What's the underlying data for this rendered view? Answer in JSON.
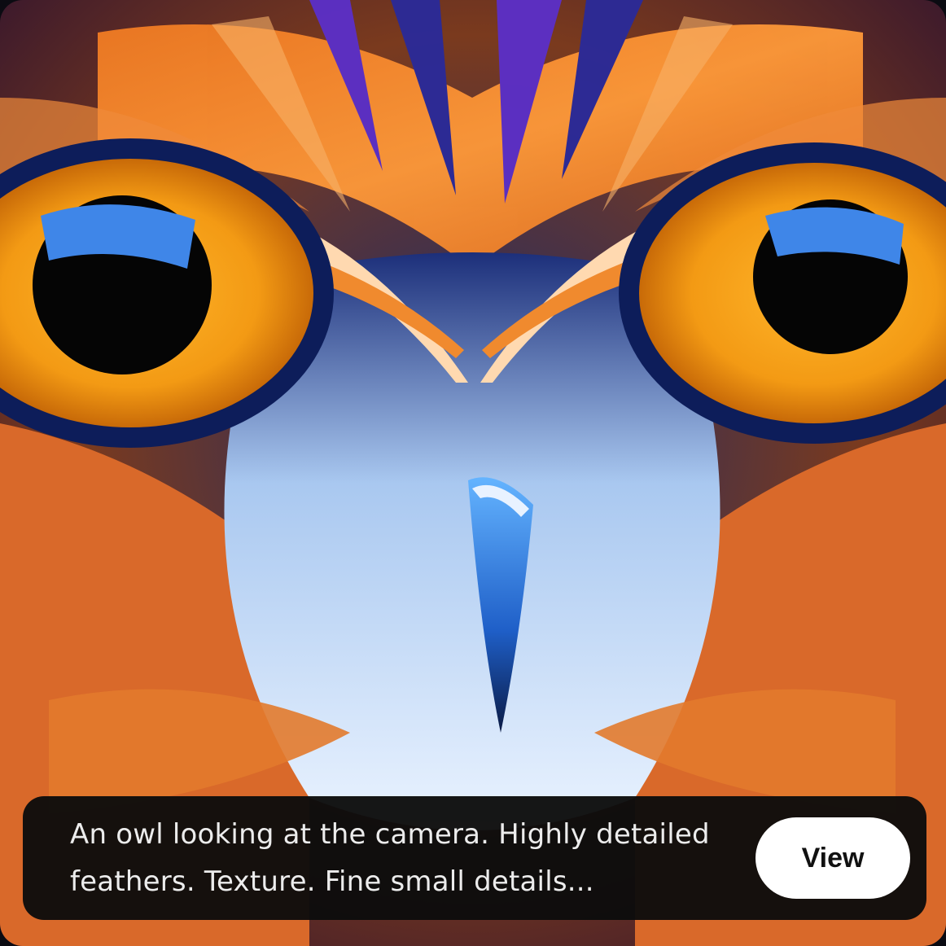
{
  "card": {
    "image_subject": "owl-face-artwork",
    "prompt_text": "An owl looking at the camera. Highly detailed feathers. Texture. Fine small details...",
    "view_label": "View"
  },
  "colors": {
    "overlay_bg": "#0c0c0c",
    "overlay_text": "#ececec",
    "button_bg": "#ffffff",
    "button_text": "#111111",
    "eye_amber": "#f5a21a",
    "feather_orange": "#f08a2e",
    "feather_blue": "#2f5fd0",
    "feather_violet": "#6a3fd8"
  }
}
